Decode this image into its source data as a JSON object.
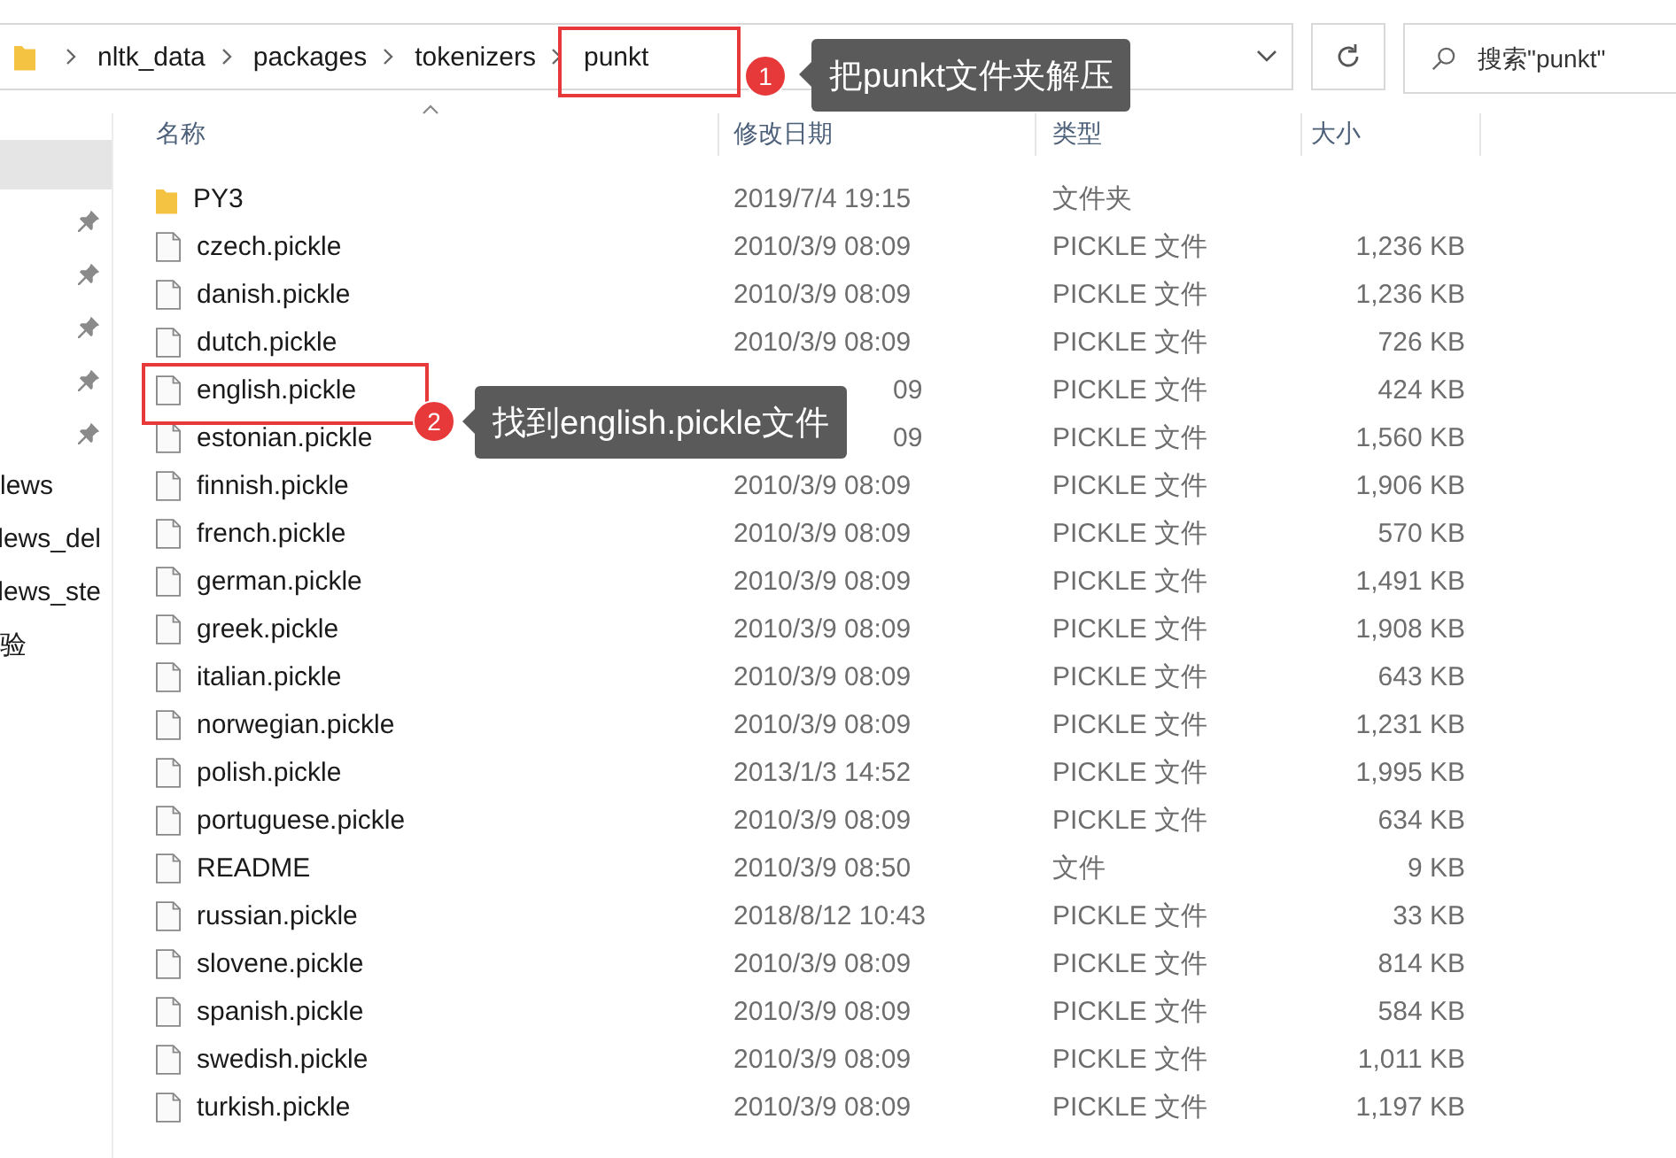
{
  "address_bar": {
    "breadcrumbs": [
      "nltk_data",
      "packages",
      "tokenizers",
      "punkt"
    ]
  },
  "search": {
    "placeholder": "搜索\"punkt\""
  },
  "sidebar": {
    "items": [
      {
        "kind": "blank",
        "selected": true
      },
      {
        "kind": "pinned",
        "selected": false
      },
      {
        "kind": "pinned",
        "selected": false
      },
      {
        "kind": "pinned",
        "selected": false
      },
      {
        "kind": "pinned",
        "selected": false
      },
      {
        "kind": "pinned",
        "selected": false
      },
      {
        "kind": "label",
        "label": "lews",
        "selected": false
      },
      {
        "kind": "label",
        "label": "lews_del",
        "selected": false
      },
      {
        "kind": "label",
        "label": "lews_ste",
        "selected": false
      },
      {
        "kind": "label",
        "label": "验",
        "selected": false
      }
    ]
  },
  "file_list": {
    "columns": [
      "名称",
      "修改日期",
      "类型",
      "大小"
    ],
    "rows": [
      {
        "kind": "folder",
        "name": "PY3",
        "modified": "2019/7/4 19:15",
        "type": "文件夹"
      },
      {
        "kind": "file",
        "name": "czech.pickle",
        "modified": "2010/3/9 08:09",
        "type": "PICKLE 文件",
        "size": "1,236 KB"
      },
      {
        "kind": "file",
        "name": "danish.pickle",
        "modified": "2010/3/9 08:09",
        "type": "PICKLE 文件",
        "size": "1,236 KB"
      },
      {
        "kind": "file",
        "name": "dutch.pickle",
        "modified": "2010/3/9 08:09",
        "type": "PICKLE 文件",
        "size": "726 KB"
      },
      {
        "kind": "file",
        "name": "english.pickle",
        "modified": "09",
        "type": "PICKLE 文件",
        "size": "424 KB"
      },
      {
        "kind": "file",
        "name": "estonian.pickle",
        "modified": "09",
        "type": "PICKLE 文件",
        "size": "1,560 KB"
      },
      {
        "kind": "file",
        "name": "finnish.pickle",
        "modified": "2010/3/9 08:09",
        "type": "PICKLE 文件",
        "size": "1,906 KB"
      },
      {
        "kind": "file",
        "name": "french.pickle",
        "modified": "2010/3/9 08:09",
        "type": "PICKLE 文件",
        "size": "570 KB"
      },
      {
        "kind": "file",
        "name": "german.pickle",
        "modified": "2010/3/9 08:09",
        "type": "PICKLE 文件",
        "size": "1,491 KB"
      },
      {
        "kind": "file",
        "name": "greek.pickle",
        "modified": "2010/3/9 08:09",
        "type": "PICKLE 文件",
        "size": "1,908 KB"
      },
      {
        "kind": "file",
        "name": "italian.pickle",
        "modified": "2010/3/9 08:09",
        "type": "PICKLE 文件",
        "size": "643 KB"
      },
      {
        "kind": "file",
        "name": "norwegian.pickle",
        "modified": "2010/3/9 08:09",
        "type": "PICKLE 文件",
        "size": "1,231 KB"
      },
      {
        "kind": "file",
        "name": "polish.pickle",
        "modified": "2013/1/3 14:52",
        "type": "PICKLE 文件",
        "size": "1,995 KB"
      },
      {
        "kind": "file",
        "name": "portuguese.pickle",
        "modified": "2010/3/9 08:09",
        "type": "PICKLE 文件",
        "size": "634 KB"
      },
      {
        "kind": "file",
        "name": "README",
        "modified": "2010/3/9 08:50",
        "type": "文件",
        "size": "9 KB"
      },
      {
        "kind": "file",
        "name": "russian.pickle",
        "modified": "2018/8/12 10:43",
        "type": "PICKLE 文件",
        "size": "33 KB"
      },
      {
        "kind": "file",
        "name": "slovene.pickle",
        "modified": "2010/3/9 08:09",
        "type": "PICKLE 文件",
        "size": "814 KB"
      },
      {
        "kind": "file",
        "name": "spanish.pickle",
        "modified": "2010/3/9 08:09",
        "type": "PICKLE 文件",
        "size": "584 KB"
      },
      {
        "kind": "file",
        "name": "swedish.pickle",
        "modified": "2010/3/9 08:09",
        "type": "PICKLE 文件",
        "size": "1,011 KB"
      },
      {
        "kind": "file",
        "name": "turkish.pickle",
        "modified": "2010/3/9 08:09",
        "type": "PICKLE 文件",
        "size": "1,197 KB"
      }
    ]
  },
  "annotations": [
    {
      "number": "1",
      "text": "把punkt文件夹解压"
    },
    {
      "number": "2",
      "text": "找到english.pickle文件"
    }
  ]
}
